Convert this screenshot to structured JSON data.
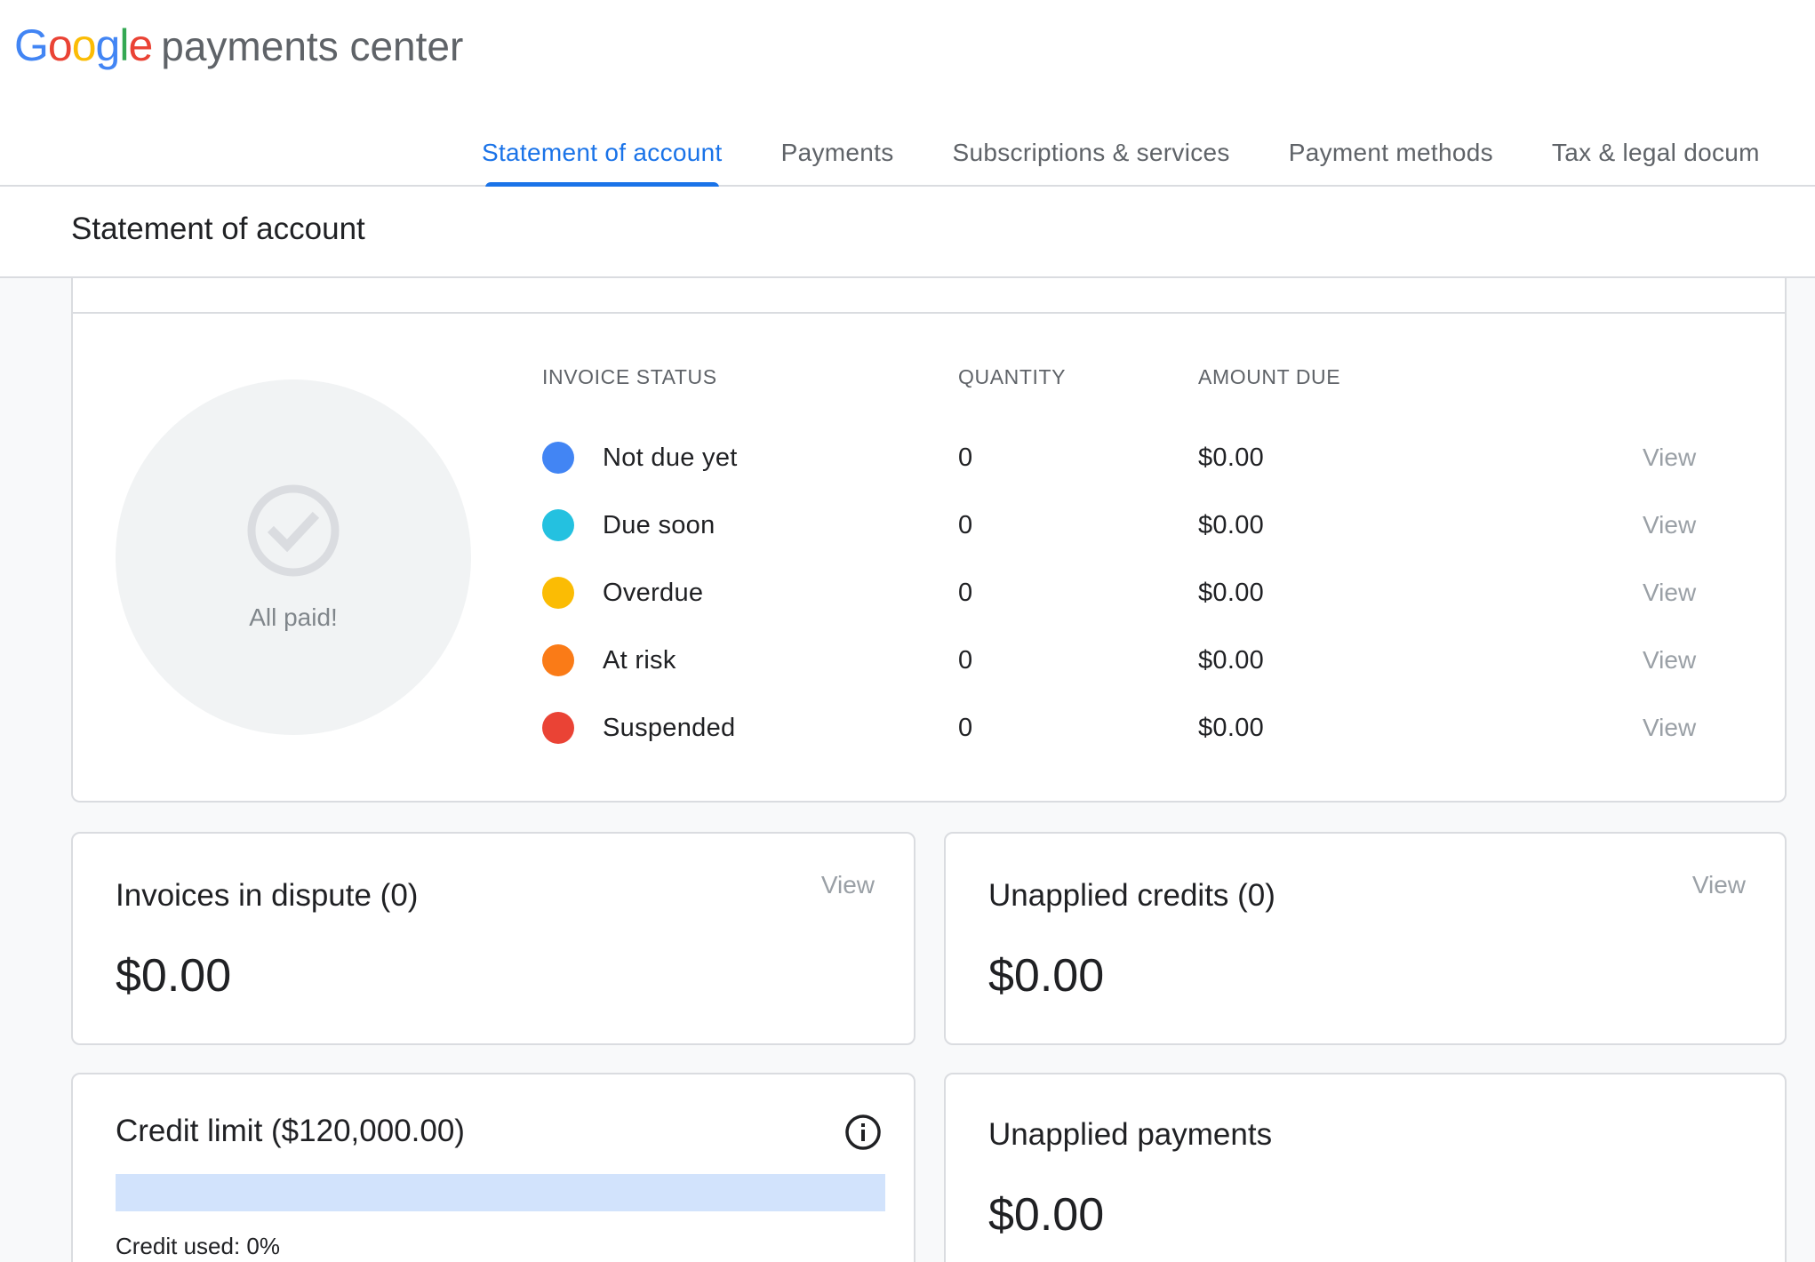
{
  "header": {
    "logo_letters": [
      "G",
      "o",
      "o",
      "g",
      "l",
      "e"
    ],
    "logo_colors": [
      "#4285F4",
      "#EA4335",
      "#FBBC05",
      "#4285F4",
      "#34A853",
      "#EA4335"
    ],
    "product": "payments center"
  },
  "tabs": [
    {
      "label": "Statement of account",
      "active": true
    },
    {
      "label": "Payments",
      "active": false
    },
    {
      "label": "Subscriptions & services",
      "active": false
    },
    {
      "label": "Payment methods",
      "active": false
    },
    {
      "label": "Tax & legal docum",
      "active": false
    }
  ],
  "page": {
    "title": "Statement of account"
  },
  "summary": {
    "donut_label": "All paid!",
    "columns": {
      "status": "INVOICE STATUS",
      "quantity": "QUANTITY",
      "amount": "AMOUNT DUE"
    },
    "rows": [
      {
        "label": "Not due yet",
        "color": "#4285F4",
        "quantity": "0",
        "amount": "$0.00",
        "action": "View"
      },
      {
        "label": "Due soon",
        "color": "#24C1E0",
        "quantity": "0",
        "amount": "$0.00",
        "action": "View"
      },
      {
        "label": "Overdue",
        "color": "#FBBC04",
        "quantity": "0",
        "amount": "$0.00",
        "action": "View"
      },
      {
        "label": "At risk",
        "color": "#FA7B17",
        "quantity": "0",
        "amount": "$0.00",
        "action": "View"
      },
      {
        "label": "Suspended",
        "color": "#EA4335",
        "quantity": "0",
        "amount": "$0.00",
        "action": "View"
      }
    ]
  },
  "disputes": {
    "title": "Invoices in dispute (0)",
    "amount": "$0.00",
    "action": "View"
  },
  "credits": {
    "title": "Unapplied credits (0)",
    "amount": "$0.00",
    "action": "View"
  },
  "credit_limit": {
    "title": "Credit limit ($120,000.00)",
    "used_label": "Credit used: 0%",
    "used_fraction": 0
  },
  "payments": {
    "title": "Unapplied payments",
    "amount": "$0.00"
  }
}
